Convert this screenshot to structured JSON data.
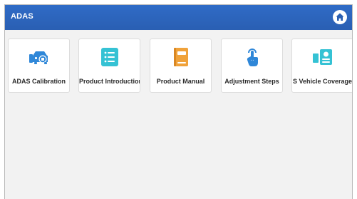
{
  "header": {
    "title": "ADAS",
    "home_icon": "home-icon"
  },
  "colors": {
    "header_blue": "#2a5fb3",
    "icon_blue": "#2f87d8",
    "icon_teal": "#35c2d4",
    "icon_orange": "#f0a23a"
  },
  "tiles": [
    {
      "label": "ADAS Calibration",
      "icon": "adas-calibration-icon"
    },
    {
      "label": "Product Introduction",
      "icon": "list-icon"
    },
    {
      "label": "Product Manual",
      "icon": "manual-book-icon"
    },
    {
      "label": "Adjustment Steps",
      "icon": "touch-hand-icon"
    },
    {
      "label": "S Vehicle Coverage",
      "icon": "vehicle-coverage-icon"
    }
  ]
}
